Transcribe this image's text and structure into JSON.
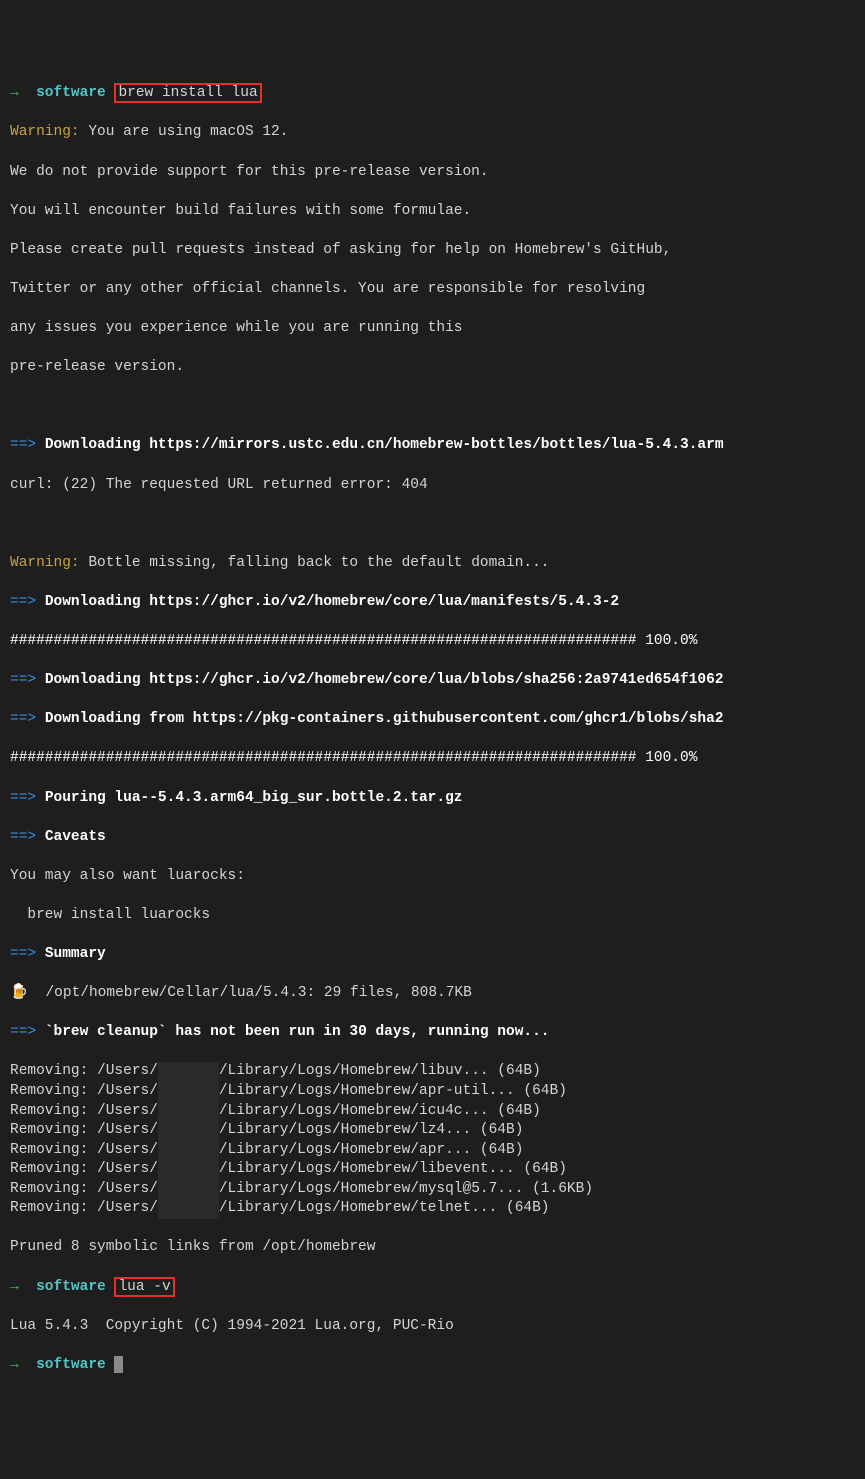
{
  "prompt1": {
    "arrow": "→",
    "host": "software",
    "command": "brew install lua"
  },
  "warning1": {
    "label": "Warning:",
    "text": " You are using macOS 12."
  },
  "preRelease": [
    "We do not provide support for this pre-release version.",
    "You will encounter build failures with some formulae.",
    "Please create pull requests instead of asking for help on Homebrew's GitHub,",
    "Twitter or any other official channels. You are responsible for resolving",
    "any issues you experience while you are running this",
    "pre-release version."
  ],
  "download1": {
    "arrow": "==>",
    "text": "Downloading https://mirrors.ustc.edu.cn/homebrew-bottles/bottles/lua-5.4.3.arm"
  },
  "curlError": "curl: (22) The requested URL returned error: 404",
  "warning2": {
    "label": "Warning:",
    "text": " Bottle missing, falling back to the default domain..."
  },
  "download2": {
    "arrow": "==>",
    "text": "Downloading https://ghcr.io/v2/homebrew/core/lua/manifests/5.4.3-2"
  },
  "progress1": "######################################################################## 100.0%",
  "download3": {
    "arrow": "==>",
    "text": "Downloading https://ghcr.io/v2/homebrew/core/lua/blobs/sha256:2a9741ed654f1062"
  },
  "download4": {
    "arrow": "==>",
    "text": "Downloading from https://pkg-containers.githubusercontent.com/ghcr1/blobs/sha2"
  },
  "progress2": "######################################################################## 100.0%",
  "pouring": {
    "arrow": "==>",
    "text": "Pouring lua--5.4.3.arm64_big_sur.bottle.2.tar.gz"
  },
  "caveats": {
    "arrow": "==>",
    "text": "Caveats"
  },
  "caveatsBody": [
    "You may also want luarocks:",
    "  brew install luarocks"
  ],
  "summary": {
    "arrow": "==>",
    "text": "Summary"
  },
  "summaryIcon": "🍺",
  "summaryPath": "/opt/homebrew/Cellar/lua/5.4.3: 29 files, 808.7KB",
  "cleanup": {
    "arrow": "==>",
    "text": "`brew cleanup` has not been run in 30 days, running now..."
  },
  "removing": [
    {
      "prefix": "Removing: /Users/",
      "redacted": "       ",
      "suffix": "/Library/Logs/Homebrew/libuv... (64B)"
    },
    {
      "prefix": "Removing: /Users/",
      "redacted": "       ",
      "suffix": "/Library/Logs/Homebrew/apr-util... (64B)"
    },
    {
      "prefix": "Removing: /Users/",
      "redacted": "       ",
      "suffix": "/Library/Logs/Homebrew/icu4c... (64B)"
    },
    {
      "prefix": "Removing: /Users/",
      "redacted": "       ",
      "suffix": "/Library/Logs/Homebrew/lz4... (64B)"
    },
    {
      "prefix": "Removing: /Users/",
      "redacted": "       ",
      "suffix": "/Library/Logs/Homebrew/apr... (64B)"
    },
    {
      "prefix": "Removing: /Users/",
      "redacted": "       ",
      "suffix": "/Library/Logs/Homebrew/libevent... (64B)"
    },
    {
      "prefix": "Removing: /Users/",
      "redacted": "       ",
      "suffix": "/Library/Logs/Homebrew/mysql@5.7... (1.6KB)"
    },
    {
      "prefix": "Removing: /Users/",
      "redacted": "       ",
      "suffix": "/Library/Logs/Homebrew/telnet... (64B)"
    }
  ],
  "pruned": "Pruned 8 symbolic links from /opt/homebrew",
  "prompt2": {
    "arrow": "→",
    "host": "software",
    "command": "lua -v"
  },
  "luaVersion": "Lua 5.4.3  Copyright (C) 1994-2021 Lua.org, PUC-Rio",
  "prompt3": {
    "arrow": "→",
    "host": "software"
  }
}
